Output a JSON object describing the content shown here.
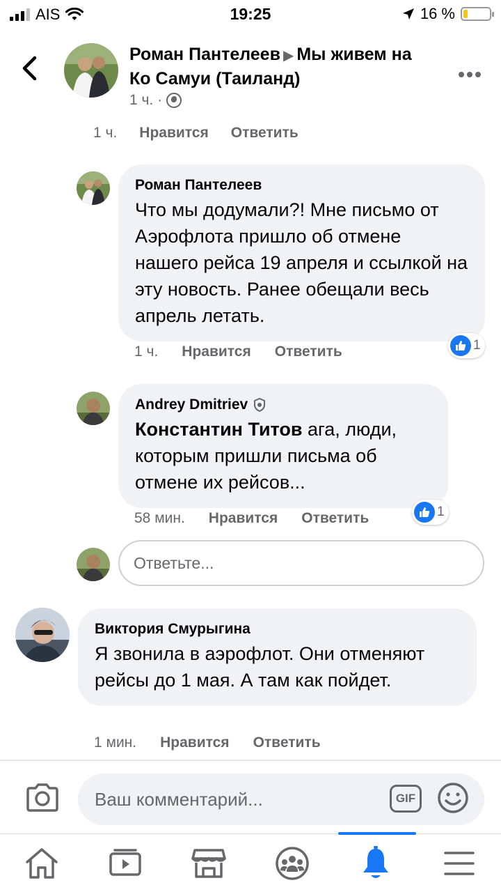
{
  "status_bar": {
    "carrier": "AIS",
    "time": "19:25",
    "battery": "16 %"
  },
  "header": {
    "author": "Роман Пантелеев",
    "arrow": "▶",
    "group": "Мы живем на Ко Самуи (Таиланд)",
    "time": "1 ч.",
    "separator": "·"
  },
  "clipped_actions": {
    "time": "1 ч.",
    "like": "Нравится",
    "reply": "Ответить"
  },
  "comments": [
    {
      "author": "Роман Пантелеев",
      "text": "Что мы додумали?! Мне письмо от Аэрофлота пришло об отмене нашего рейса 19 апреля и ссылкой на эту новость. Ранее обещали весь апрель летать.",
      "time": "1 ч.",
      "like": "Нравится",
      "reply": "Ответить",
      "reactions": "1"
    },
    {
      "author": "Andrey Dmitriev",
      "mention": "Константин Титов",
      "text": " ага, люди, которым пришли письма об отмене их рейсов...",
      "time": "58 мин.",
      "like": "Нравится",
      "reply": "Ответить",
      "reactions": "1"
    },
    {
      "author": "Виктория Смурыгина",
      "text": "Я звонила в аэрофлот. Они отменяют рейсы до 1 мая. А там как пойдет.",
      "time": "1 мин.",
      "like": "Нравится",
      "reply": "Ответить"
    }
  ],
  "reply_input": {
    "placeholder": "Ответьте..."
  },
  "composer": {
    "placeholder": "Ваш комментарий...",
    "gif": "GIF"
  },
  "tabs": [
    {
      "icon": "home-icon"
    },
    {
      "icon": "video-icon"
    },
    {
      "icon": "marketplace-icon"
    },
    {
      "icon": "groups-icon"
    },
    {
      "icon": "notifications-bell-icon",
      "active": true
    },
    {
      "icon": "menu-icon"
    }
  ],
  "colors": {
    "accent": "#1877f2",
    "bubble": "#f0f2f5",
    "muted": "#65676b"
  }
}
